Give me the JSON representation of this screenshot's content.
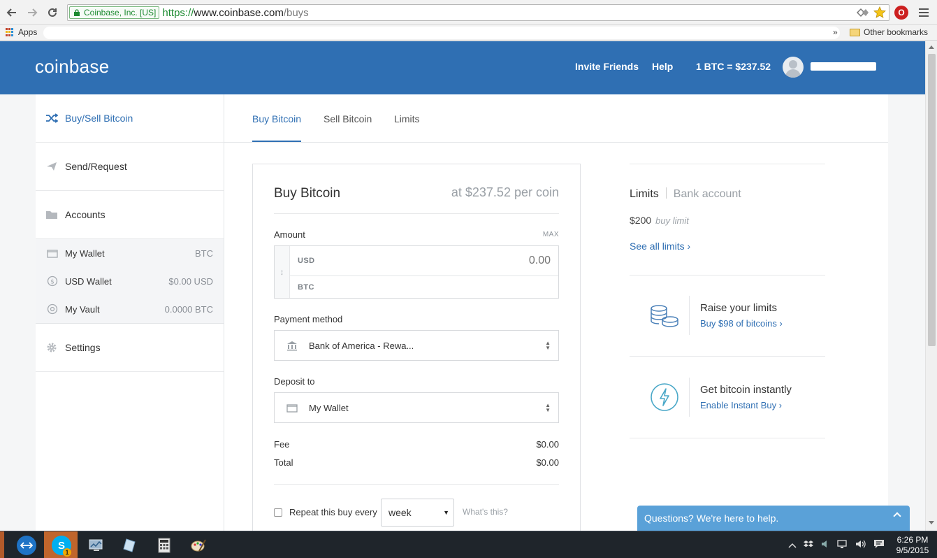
{
  "browser": {
    "ev_badge": "Coinbase, Inc. [US]",
    "url_proto": "https://",
    "url_host": "www.coinbase.com",
    "url_path": "/buys",
    "bookmarks": {
      "apps_label": "Apps",
      "overflow": "»",
      "other_label": "Other bookmarks"
    },
    "ext_label": "O"
  },
  "header": {
    "logo": "coinbase",
    "nav": {
      "invite": "Invite Friends",
      "help": "Help",
      "price": "1 BTC = $237.52"
    }
  },
  "sidebar": {
    "items": [
      {
        "label": "Buy/Sell Bitcoin",
        "icon": "shuffle-icon"
      },
      {
        "label": "Send/Request",
        "icon": "paper-plane-icon"
      },
      {
        "label": "Accounts",
        "icon": "folder-icon"
      },
      {
        "label": "Settings",
        "icon": "gear-icon"
      }
    ],
    "wallets": [
      {
        "label": "My Wallet",
        "value": "BTC",
        "icon": "wallet-icon"
      },
      {
        "label": "USD Wallet",
        "value": "$0.00 USD",
        "icon": "dollar-circle-icon"
      },
      {
        "label": "My Vault",
        "value": "0.0000 BTC",
        "icon": "vault-icon"
      }
    ]
  },
  "tabs": [
    {
      "label": "Buy Bitcoin"
    },
    {
      "label": "Sell Bitcoin"
    },
    {
      "label": "Limits"
    }
  ],
  "buy_form": {
    "title": "Buy Bitcoin",
    "price": "at $237.52 per coin",
    "amount_label": "Amount",
    "max_label": "MAX",
    "usd_label": "USD",
    "usd_placeholder": "0.00",
    "btc_label": "BTC",
    "payment_label": "Payment method",
    "payment_value": "Bank of America - Rewa...",
    "deposit_label": "Deposit to",
    "deposit_value": "My Wallet",
    "fee_label": "Fee",
    "fee_value": "$0.00",
    "total_label": "Total",
    "total_value": "$0.00",
    "repeat_label": "Repeat this buy every",
    "repeat_value": "week",
    "whats_this": "What's this?"
  },
  "right_panel": {
    "limits_tab": "Limits",
    "bank_tab": "Bank account",
    "limit_amount": "$200",
    "limit_label": "buy limit",
    "see_all": "See all limits ›",
    "raise_title": "Raise your limits",
    "raise_link": "Buy $98 of bitcoins ›",
    "instant_title": "Get bitcoin instantly",
    "instant_link": "Enable Instant Buy ›"
  },
  "chat": {
    "label": "Questions? We're here to help."
  },
  "taskbar": {
    "time": "6:26 PM",
    "date": "9/5/2015",
    "skype_badge": "1"
  },
  "colors": {
    "brand_blue": "#2f6fb3",
    "chat_blue": "#5aa1d8",
    "ev_green": "#1c8a30"
  }
}
